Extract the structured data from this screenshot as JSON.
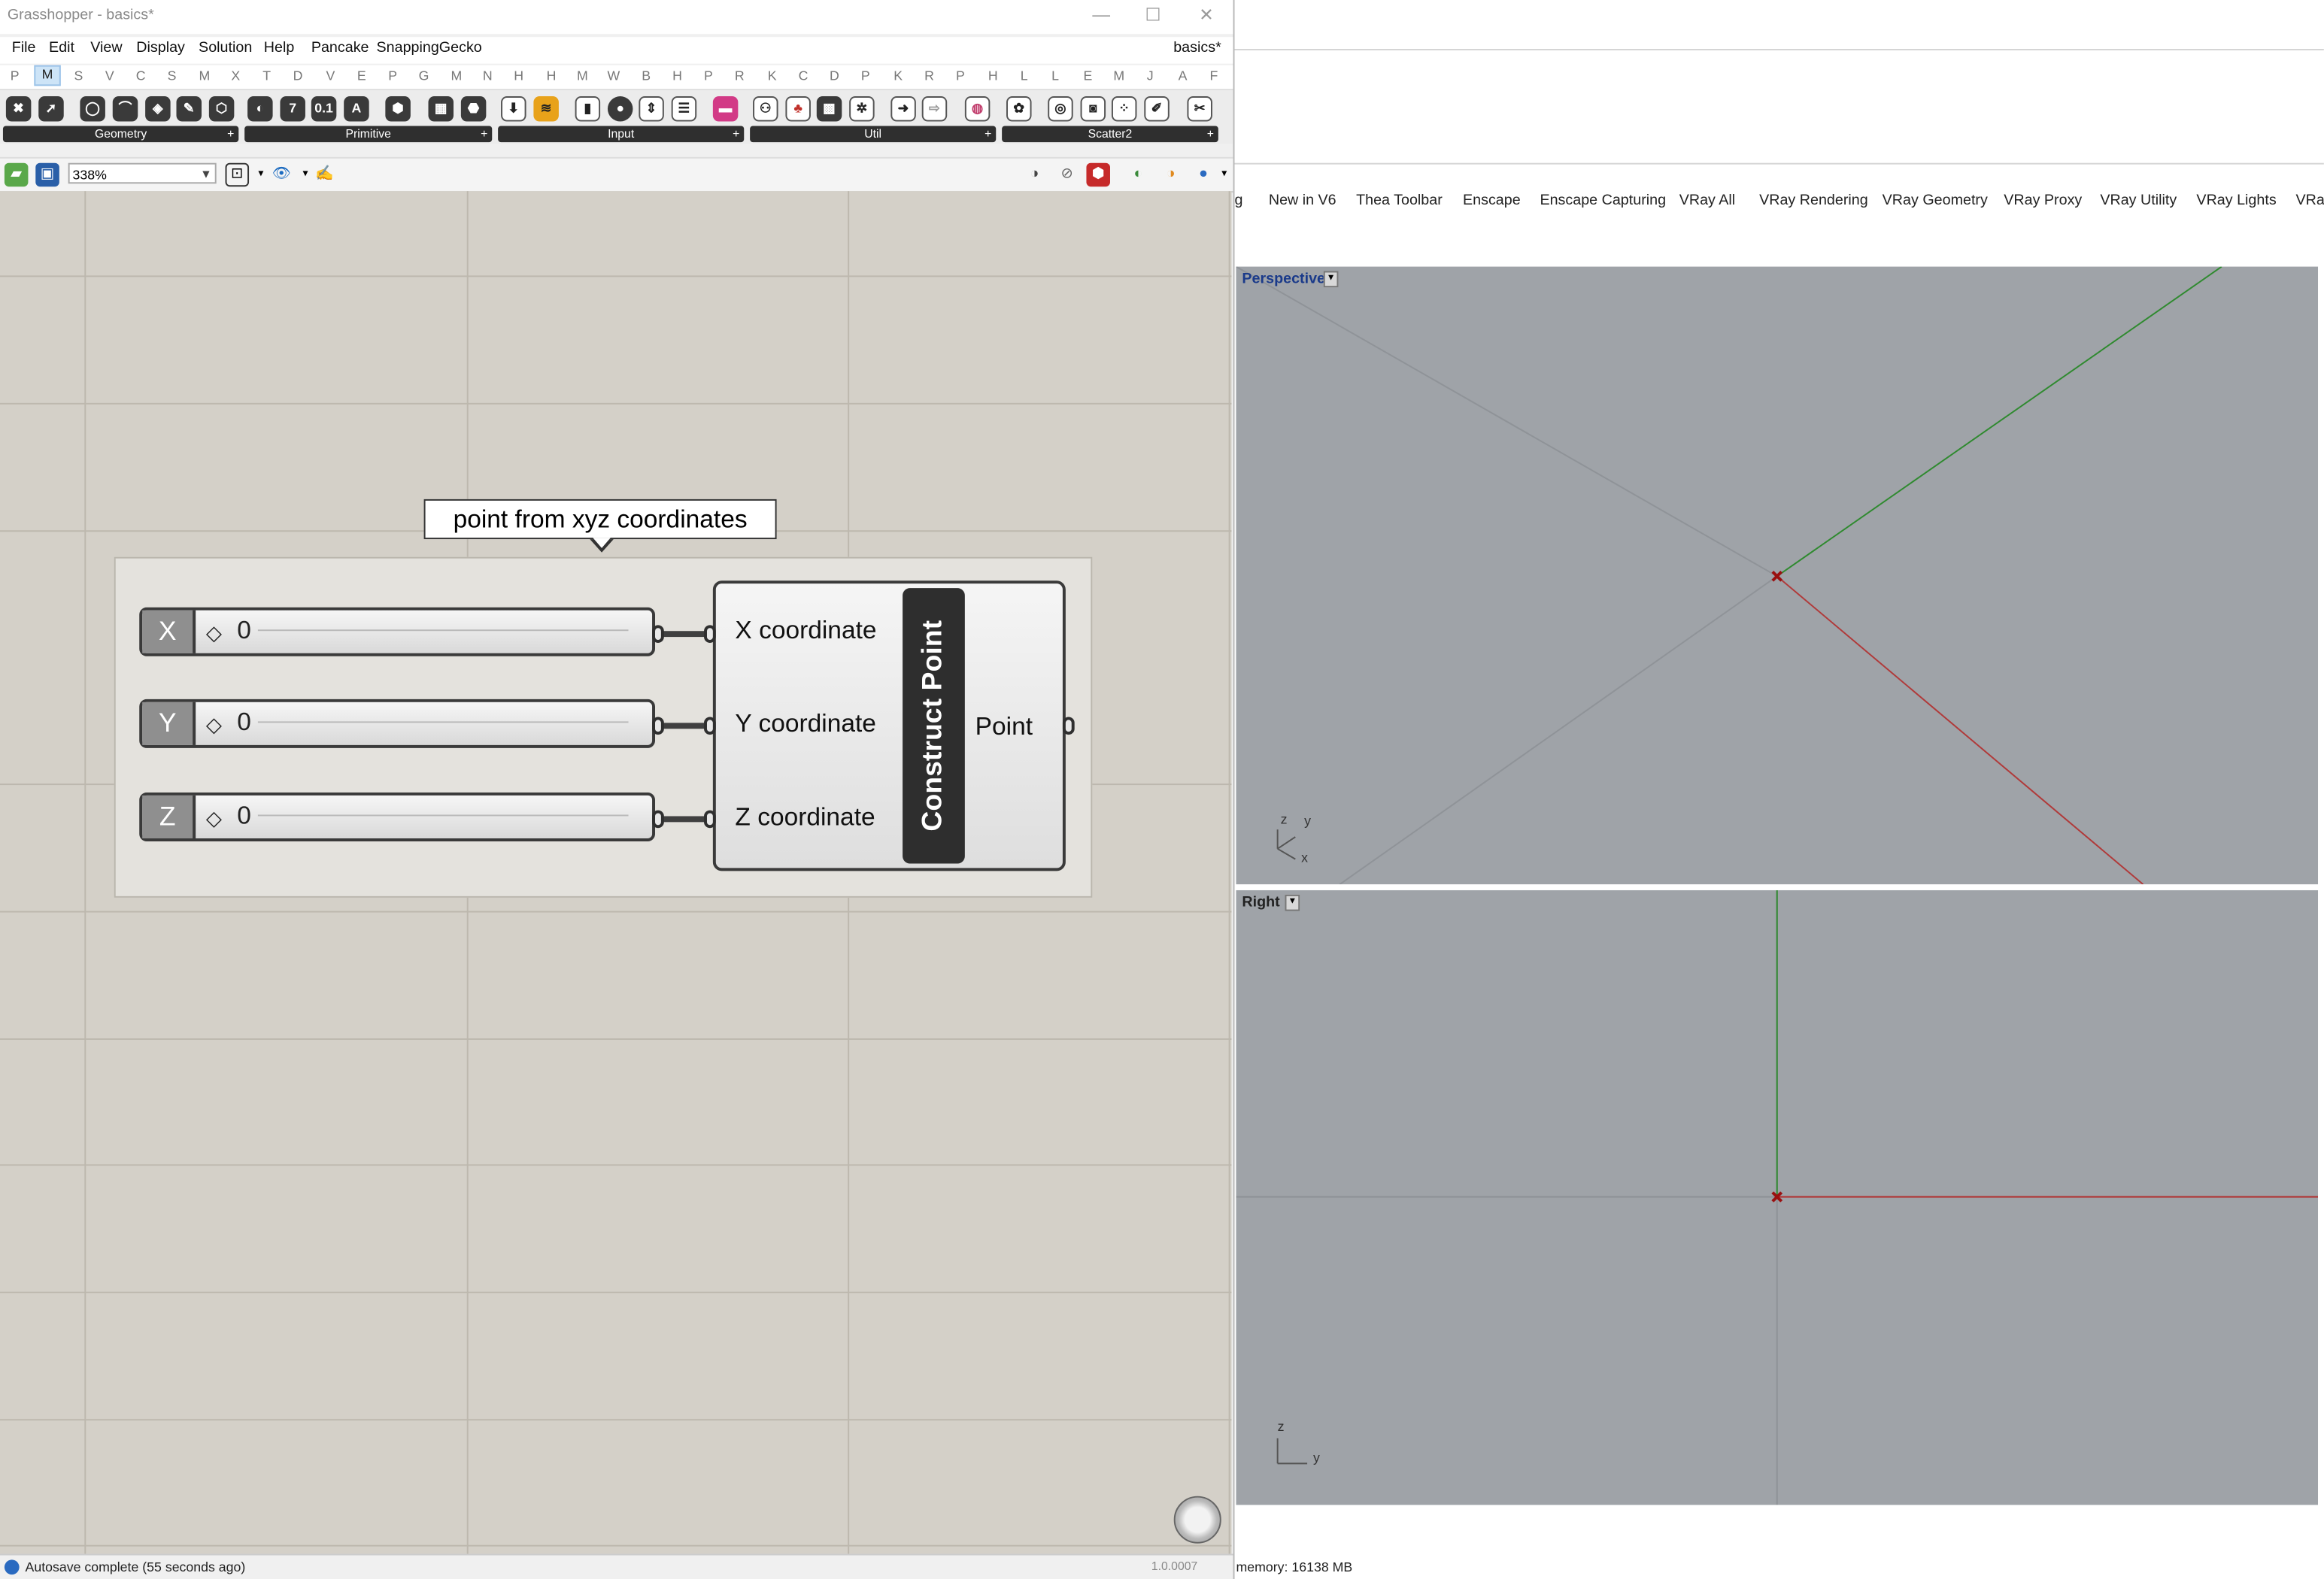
{
  "window": {
    "title": "Grasshopper - basics*",
    "document_name": "basics*",
    "controls": [
      "—",
      "☐",
      "✕"
    ]
  },
  "menu": [
    "File",
    "Edit",
    "View",
    "Display",
    "Solution",
    "Help",
    "Pancake",
    "SnappingGecko"
  ],
  "tab_letters": [
    "P",
    "M",
    "S",
    "V",
    "C",
    "S",
    "M",
    "X",
    "T",
    "D",
    "V",
    "E",
    "P",
    "G",
    "M",
    "N",
    "H",
    "H",
    "M",
    "W",
    "B",
    "H",
    "P",
    "R",
    "K",
    "C",
    "D",
    "P",
    "K",
    "R",
    "P",
    "H",
    "L",
    "L",
    "E",
    "M",
    "J",
    "A",
    "F"
  ],
  "component_groups": [
    {
      "label": "Geometry"
    },
    {
      "label": "Primitive"
    },
    {
      "label": "Input"
    },
    {
      "label": "Util"
    },
    {
      "label": "Scatter2"
    }
  ],
  "group_expand": "+",
  "primitive_icon_labels": [
    "7",
    "0.1",
    "A"
  ],
  "zoom": {
    "value": "338%"
  },
  "canvas": {
    "group_label": "point from xyz coordinates",
    "sliders": [
      {
        "label": "X",
        "value": "0"
      },
      {
        "label": "Y",
        "value": "0"
      },
      {
        "label": "Z",
        "value": "0"
      }
    ],
    "component": {
      "name": "Construct Point",
      "inputs": [
        "X coordinate",
        "Y coordinate",
        "Z coordinate"
      ],
      "output": "Point"
    }
  },
  "status": {
    "text": "Autosave complete (55 seconds ago)",
    "version": "1.0.0007"
  },
  "rhino": {
    "tabs": [
      "g",
      "New in V6",
      "Thea Toolbar",
      "Enscape",
      "Enscape Capturing",
      "VRay All",
      "VRay Rendering",
      "VRay Geometry",
      "VRay Proxy",
      "VRay Utility",
      "VRay Lights",
      "VRa"
    ],
    "viewports": [
      {
        "name": "Perspective",
        "axes": [
          "z",
          "y",
          "x"
        ]
      },
      {
        "name": "Right",
        "axes": [
          "z",
          "y"
        ]
      }
    ],
    "memory": "memory: 16138 MB"
  },
  "colors": {
    "canvas": "#d4d0c8",
    "viewport": "#9fa3a8",
    "x_axis": "#b03a3a",
    "y_axis": "#3a9a3a",
    "accent_orange": "#e8a21a",
    "accent_pink": "#d23a86"
  }
}
